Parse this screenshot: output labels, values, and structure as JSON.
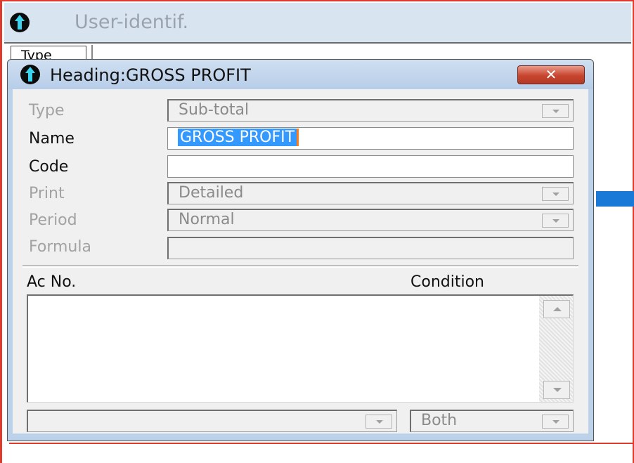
{
  "background_window": {
    "title": "User-identif.",
    "type_tab": "Type"
  },
  "dialog": {
    "title": "Heading:GROSS PROFIT",
    "close_label": "✕",
    "fields": {
      "type": {
        "label": "Type",
        "value": "Sub-total",
        "enabled": false
      },
      "name": {
        "label": "Name",
        "value": "GROSS PROFIT",
        "enabled": true
      },
      "code": {
        "label": "Code",
        "value": "",
        "enabled": true
      },
      "print": {
        "label": "Print",
        "value": "Detailed",
        "enabled": false
      },
      "period": {
        "label": "Period",
        "value": "Normal",
        "enabled": false
      },
      "formula": {
        "label": "Formula",
        "value": "",
        "enabled": false
      }
    },
    "list": {
      "col_ac_no": "Ac No.",
      "col_condition": "Condition",
      "rows": []
    },
    "bottom": {
      "account_combo_value": "",
      "condition_combo_value": "Both"
    }
  },
  "colors": {
    "selection": "#3399ff",
    "close_button": "#c8452f",
    "title_bar": "#bcd1ea",
    "window_border": "#e03a2c"
  },
  "icons": [
    "app-up-arrow-icon",
    "close-icon",
    "dropdown-arrow-icon",
    "scroll-up-icon",
    "scroll-down-icon"
  ]
}
